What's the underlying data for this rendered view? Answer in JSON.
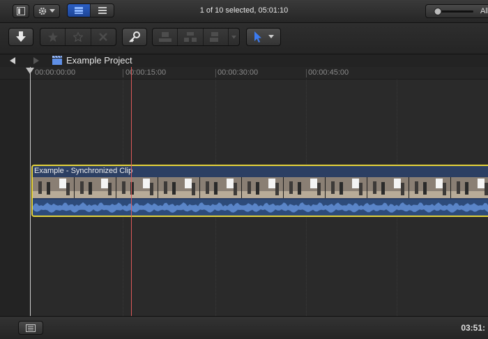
{
  "topbar": {
    "selection_status": "1 of 10 selected, 05:01:10",
    "zoom_label": "All"
  },
  "navbar": {
    "project_name": "Example Project"
  },
  "ruler": {
    "timecodes": [
      "00:00:00:00",
      "00:00:15:00",
      "00:00:30:00",
      "00:00:45:00"
    ]
  },
  "clip": {
    "title": "Example - Synchronized Clip"
  },
  "bottombar": {
    "duration": "03:51:"
  },
  "colors": {
    "clip_border": "#e6d33a",
    "clip_body": "#2c3f63",
    "skimmer": "#e05a5a",
    "tool_blue": "#3c7bf0"
  },
  "icons": {
    "view_toggle": "sidebar-icon",
    "settings": "gear-icon",
    "import": "down-arrow-icon",
    "favorite": "star-icon",
    "unrate": "outline-star-icon",
    "reject": "x-icon",
    "keywords": "key-icon",
    "tool": "arrow-pointer-icon"
  }
}
